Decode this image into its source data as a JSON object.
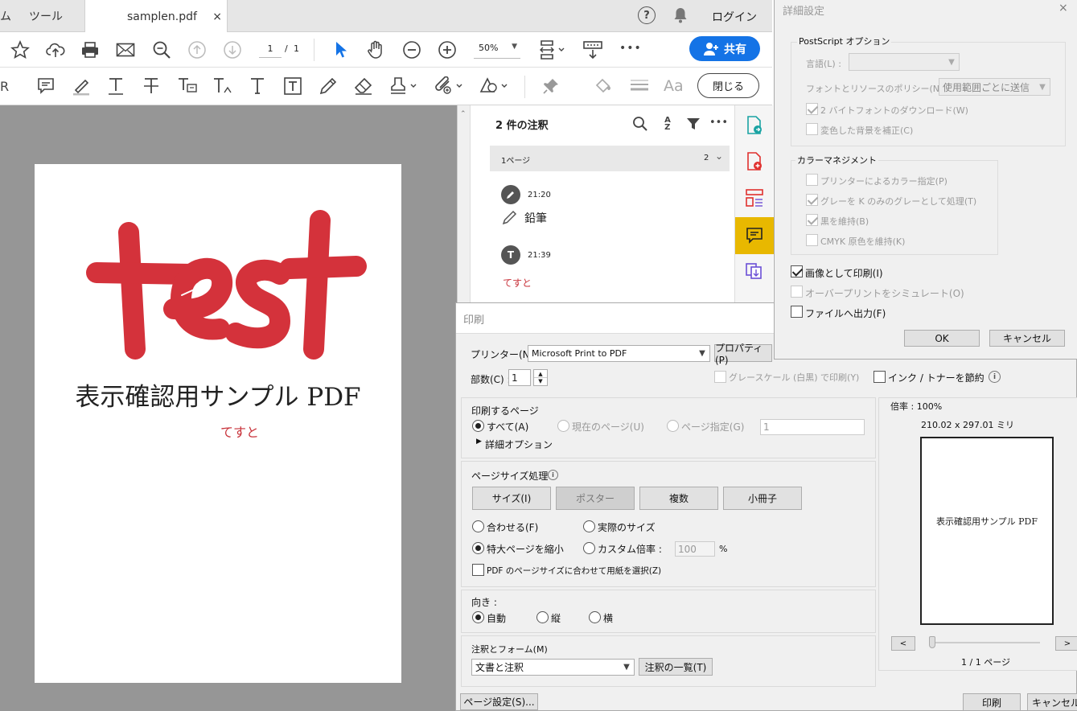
{
  "tabs": {
    "home_partial": "ム",
    "tools": "ツール",
    "file": "samplen.pdf",
    "close": "×"
  },
  "header": {
    "login": "ログイン",
    "help": "?",
    "bell": "bell"
  },
  "toolbar": {
    "page_current": "1",
    "page_sep": "/",
    "page_total": "1",
    "zoom": "50%",
    "share": "共有",
    "close": "閉じる",
    "more": "•••"
  },
  "document": {
    "big_text": "test",
    "title": "表示確認用サンプル PDF",
    "subtitle": "てすと"
  },
  "comments": {
    "header": "2 件の注釈",
    "group_label": "1ページ",
    "group_count": "2",
    "items": [
      {
        "time": "21:20",
        "type_label": "鉛筆",
        "icon": "pencil-icon"
      },
      {
        "time": "21:39",
        "body": "てすと",
        "icon": "text-icon"
      }
    ]
  },
  "print": {
    "title": "印刷",
    "printer_label": "プリンター(N) :",
    "printer_value": "Microsoft Print to PDF",
    "properties": "プロパティ(P)",
    "copies_label": "部数(C) :",
    "copies_value": "1",
    "grayscale": "グレースケール (白黒) で印刷(Y)",
    "save_ink": "インク / トナーを節約",
    "pages_title": "印刷するページ",
    "all": "すべて(A)",
    "current": "現在のページ(U)",
    "page_spec": "ページ指定(G)",
    "page_spec_value": "1",
    "more_options": "詳細オプション",
    "size_title": "ページサイズ処理",
    "btn_size": "サイズ(I)",
    "btn_poster": "ポスター",
    "btn_multiple": "複数",
    "btn_booklet": "小冊子",
    "fit": "合わせる(F)",
    "actual": "実際のサイズ",
    "shrink": "特大ページを縮小",
    "custom": "カスタム倍率 :",
    "custom_value": "100",
    "percent": "%",
    "choose_paper": "PDF のページサイズに合わせて用紙を選択(Z)",
    "orient_title": "向き :",
    "auto": "自動",
    "portrait": "縦",
    "landscape": "横",
    "comments_title": "注釈とフォーム(M)",
    "comments_value": "文書と注釈",
    "comments_list": "注釈の一覧(T)",
    "page_setup": "ページ設定(S)...",
    "print_btn": "印刷",
    "cancel_btn": "キャンセル",
    "scale": "倍率 : 100%",
    "dims": "210.02 x 297.01 ミリ",
    "preview_text": "表示確認用サンプル PDF",
    "page_count": "1 / 1 ページ",
    "prev": "<",
    "next": ">"
  },
  "advanced": {
    "title": "詳細設定",
    "close": "×",
    "ps_title": "PostScript オプション",
    "language": "言語(L) :",
    "font_policy": "フォントとリソースのポリシー(N) :",
    "font_policy_value": "使用範囲ごとに送信",
    "dl_2byte": "2 バイトフォントのダウンロード(W)",
    "fix_bg": "変色した背景を補正(C)",
    "color_title": "カラーマネジメント",
    "printer_color": "プリンターによるカラー指定(P)",
    "gray_k": "グレーを K のみのグレーとして処理(T)",
    "keep_black": "黒を維持(B)",
    "keep_cmyk": "CMYK 原色を維持(K)",
    "print_as_image": "画像として印刷(I)",
    "simulate_overprint": "オーバープリントをシミュレート(O)",
    "print_to_file": "ファイルへ出力(F)",
    "ok": "OK",
    "cancel": "キャンセル"
  },
  "colors": {
    "accent": "#1473e6",
    "ink_red": "#d4323b",
    "selected_rail": "#e8b800"
  }
}
